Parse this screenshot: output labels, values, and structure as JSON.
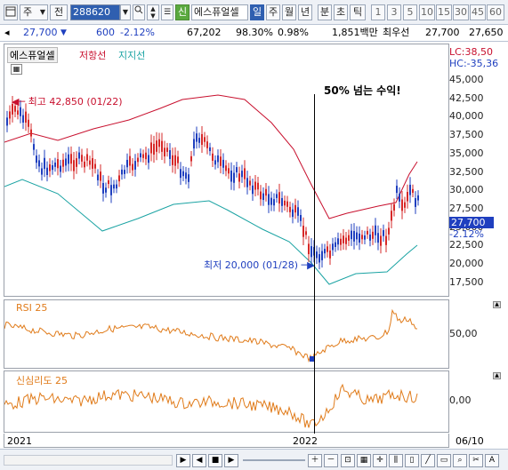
{
  "toolbar": {
    "market_label": "주",
    "type_label": "전",
    "code": "288620",
    "toggle_label": "신",
    "stock_name": "에스퓨얼셀",
    "periods": [
      "일",
      "주",
      "월",
      "년",
      "분",
      "초",
      "틱"
    ],
    "active_period": "일",
    "intervals": [
      "1",
      "3",
      "5",
      "10",
      "15",
      "30",
      "45",
      "60"
    ]
  },
  "quote": {
    "price": "27,700",
    "change": "600",
    "change_pct": "-2.12%",
    "volume": "67,202",
    "vol_ratio": "98.30%",
    "turnover": "0.98%",
    "amount": "1,851백만",
    "prefer_label": "최우선",
    "ask": "27,700",
    "bid": "27,650"
  },
  "price_pane": {
    "legend": [
      "에스퓨얼셀",
      "저항선",
      "지지선"
    ],
    "annotation_high": "최고 42,850 (01/22)",
    "annotation_low": "최저 20,000 (01/28)",
    "callout": "50% 넘는 수익!",
    "lc_label": "LC:38,50",
    "hc_label": "HC:-35,36",
    "price_tag": "27,700",
    "pct_tag": "-2.12%",
    "yticks": [
      "45,000",
      "42,500",
      "40,000",
      "37,500",
      "35,000",
      "32,500",
      "30,000",
      "27,500",
      "25,000",
      "22,500",
      "20,000",
      "17,500"
    ]
  },
  "rsi_pane": {
    "title": "RSI 25",
    "ytick": "50,00"
  },
  "psy_pane": {
    "title": "신심리도 25",
    "ytick": "0,00"
  },
  "xaxis": {
    "labels": [
      "2021",
      "2022"
    ],
    "date": "06/10"
  },
  "colors": {
    "candle_up": "#d62828",
    "candle_down": "#1f3fbf",
    "resistance": "#c8102e",
    "support": "#1aa3a3",
    "indicator": "#e07b1a"
  }
}
